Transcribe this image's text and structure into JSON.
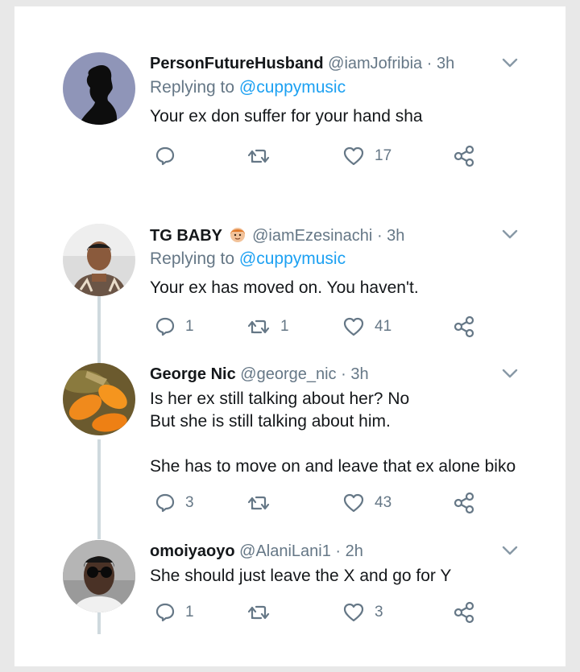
{
  "colors": {
    "name": "#14171a",
    "muted": "#657786",
    "link": "#1da1f2",
    "thread_line": "#cfd9de",
    "background": "#e8e8e8"
  },
  "tweets": [
    {
      "display_name": "PersonFutureHusband",
      "handle": "@iamJofribia",
      "dot": "·",
      "time": "3h",
      "replying_prefix": "Replying to ",
      "replying_to": "@cuppymusic",
      "text": "Your ex don suffer for your hand sha",
      "reply_count": "",
      "retweet_count": "",
      "like_count": "17",
      "avatar_icon": "silhouette-avatar"
    },
    {
      "display_name": "TG BABY",
      "name_emoji": "boy-emoji-icon",
      "handle": "@iamEzesinachi",
      "dot": "·",
      "time": "3h",
      "replying_prefix": "Replying to ",
      "replying_to": "@cuppymusic",
      "text": "Your ex has moved on. You haven't.",
      "reply_count": "1",
      "retweet_count": "1",
      "like_count": "41",
      "avatar_icon": "photo-avatar"
    },
    {
      "display_name": "George Nic",
      "handle": "@george_nic",
      "dot": "·",
      "time": "3h",
      "text": "Is her ex still talking about her? No\nBut she is still talking about him.\n\nShe has to move on and leave that ex alone biko",
      "reply_count": "3",
      "retweet_count": "",
      "like_count": "43",
      "avatar_icon": "fruit-avatar"
    },
    {
      "display_name": "omoiyaoyo",
      "handle": "@AlaniLani1",
      "dot": "·",
      "time": "2h",
      "text": "She should just leave the X and go for Y",
      "reply_count": "1",
      "retweet_count": "",
      "like_count": "3",
      "avatar_icon": "sunglasses-avatar"
    }
  ]
}
